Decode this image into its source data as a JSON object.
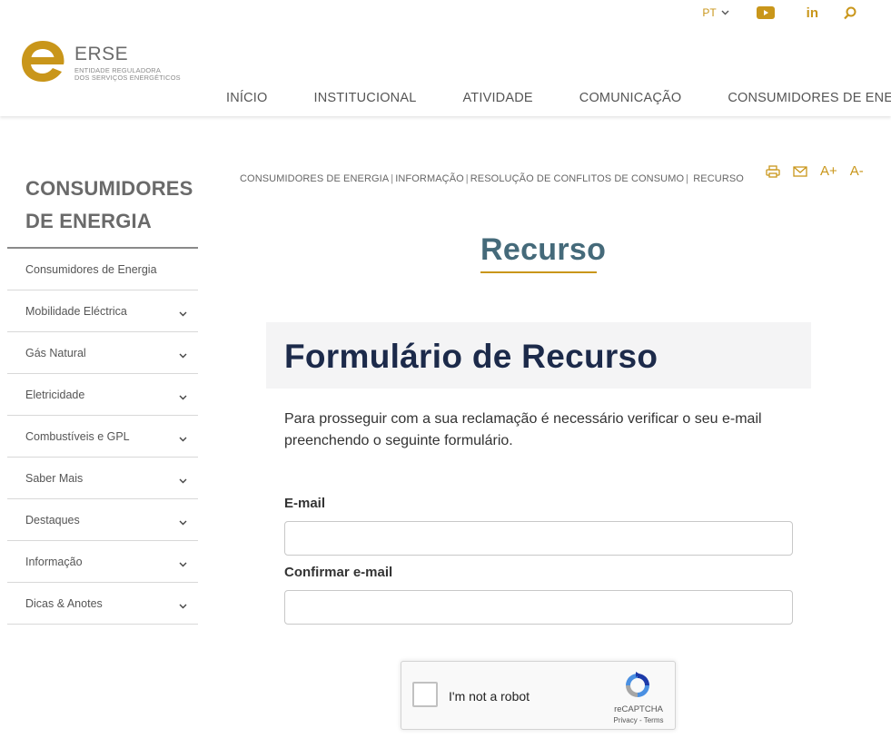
{
  "brand": {
    "name": "ERSE",
    "subtitle_line1": "ENTIDADE REGULADORA",
    "subtitle_line2": "DOS SERVIÇOS ENERGÉTICOS",
    "accent_color": "#c9961a",
    "logo_letter_icon": "e-letter-logo-icon"
  },
  "utility": {
    "language": "PT",
    "icons": [
      "youtube-icon",
      "linkedin-icon",
      "search-icon"
    ],
    "linkedin_text": "in"
  },
  "nav": {
    "items": [
      "INÍCIO",
      "INSTITUCIONAL",
      "ATIVIDADE",
      "COMUNICAÇÃO",
      "CONSUMIDORES DE ENERGIA"
    ]
  },
  "sidebar": {
    "title_line1": "CONSUMIDORES",
    "title_line2": "DE ENERGIA",
    "items": [
      {
        "label": "Consumidores de Energia",
        "expandable": false
      },
      {
        "label": "Mobilidade Eléctrica",
        "expandable": true
      },
      {
        "label": "Gás Natural",
        "expandable": true
      },
      {
        "label": "Eletricidade",
        "expandable": true
      },
      {
        "label": "Combustíveis e GPL",
        "expandable": true
      },
      {
        "label": "Saber Mais",
        "expandable": true
      },
      {
        "label": "Destaques",
        "expandable": true
      },
      {
        "label": "Informação",
        "expandable": true
      },
      {
        "label": "Dicas & Anotes",
        "expandable": true
      }
    ]
  },
  "breadcrumb": {
    "items": [
      "CONSUMIDORES DE ENERGIA",
      "INFORMAÇÃO",
      "RESOLUÇÃO DE CONFLITOS DE CONSUMO",
      "RECURSO"
    ],
    "separator": "|"
  },
  "tools": {
    "icons": [
      "print-icon",
      "mail-icon"
    ],
    "font_increase": "A+",
    "font_decrease": "A-"
  },
  "main": {
    "page_title": "Recurso",
    "form_heading": "Formulário de Recurso",
    "intro": "Para prosseguir com a sua reclamação é necessário verificar o seu e-mail preenchendo o seguinte formulário.",
    "email_label": "E-mail",
    "email_value": "",
    "confirm_label": "Confirmar e-mail",
    "confirm_value": ""
  },
  "recaptcha": {
    "label": "I'm not a robot",
    "brand": "reCAPTCHA",
    "privacy": "Privacy",
    "terms": "Terms",
    "link_separator": " - "
  }
}
